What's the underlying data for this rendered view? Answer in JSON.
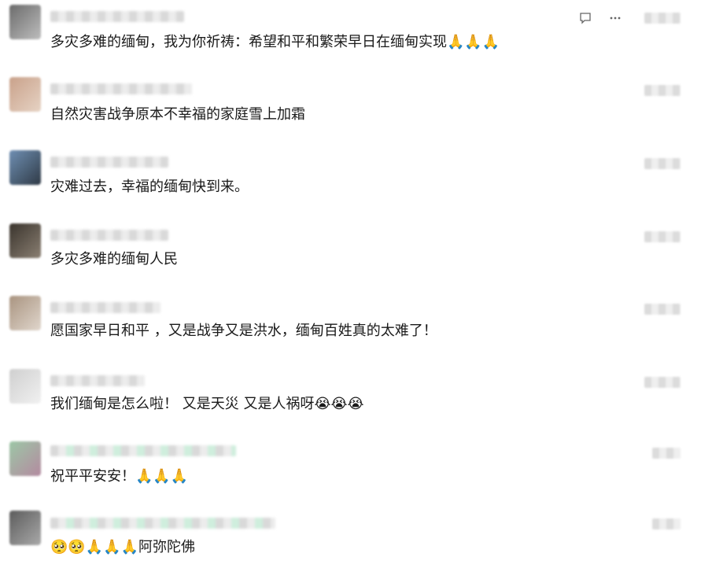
{
  "comments": [
    {
      "text": "多灾多难的缅甸，我为你祈祷：希望和平和繁荣早日在缅甸实现🙏🙏🙏"
    },
    {
      "text": "自然灾害战争原本不幸福的家庭雪上加霜"
    },
    {
      "text": "灾难过去，幸福的缅甸快到来。"
    },
    {
      "text": "多灾多难的缅甸人民"
    },
    {
      "text": "愿国家早日和平 ，又是战争又是洪水，缅甸百姓真的太难了！"
    },
    {
      "text": "我们缅甸是怎么啦！   又是天災   又是人祸呀😭😭😭"
    },
    {
      "text": "祝平平安安！🙏🙏🙏"
    },
    {
      "text": "🥺🥺🙏🙏🙏阿弥陀佛"
    }
  ],
  "icons": {
    "reply": "comment-icon",
    "more": "more-dots-icon"
  }
}
